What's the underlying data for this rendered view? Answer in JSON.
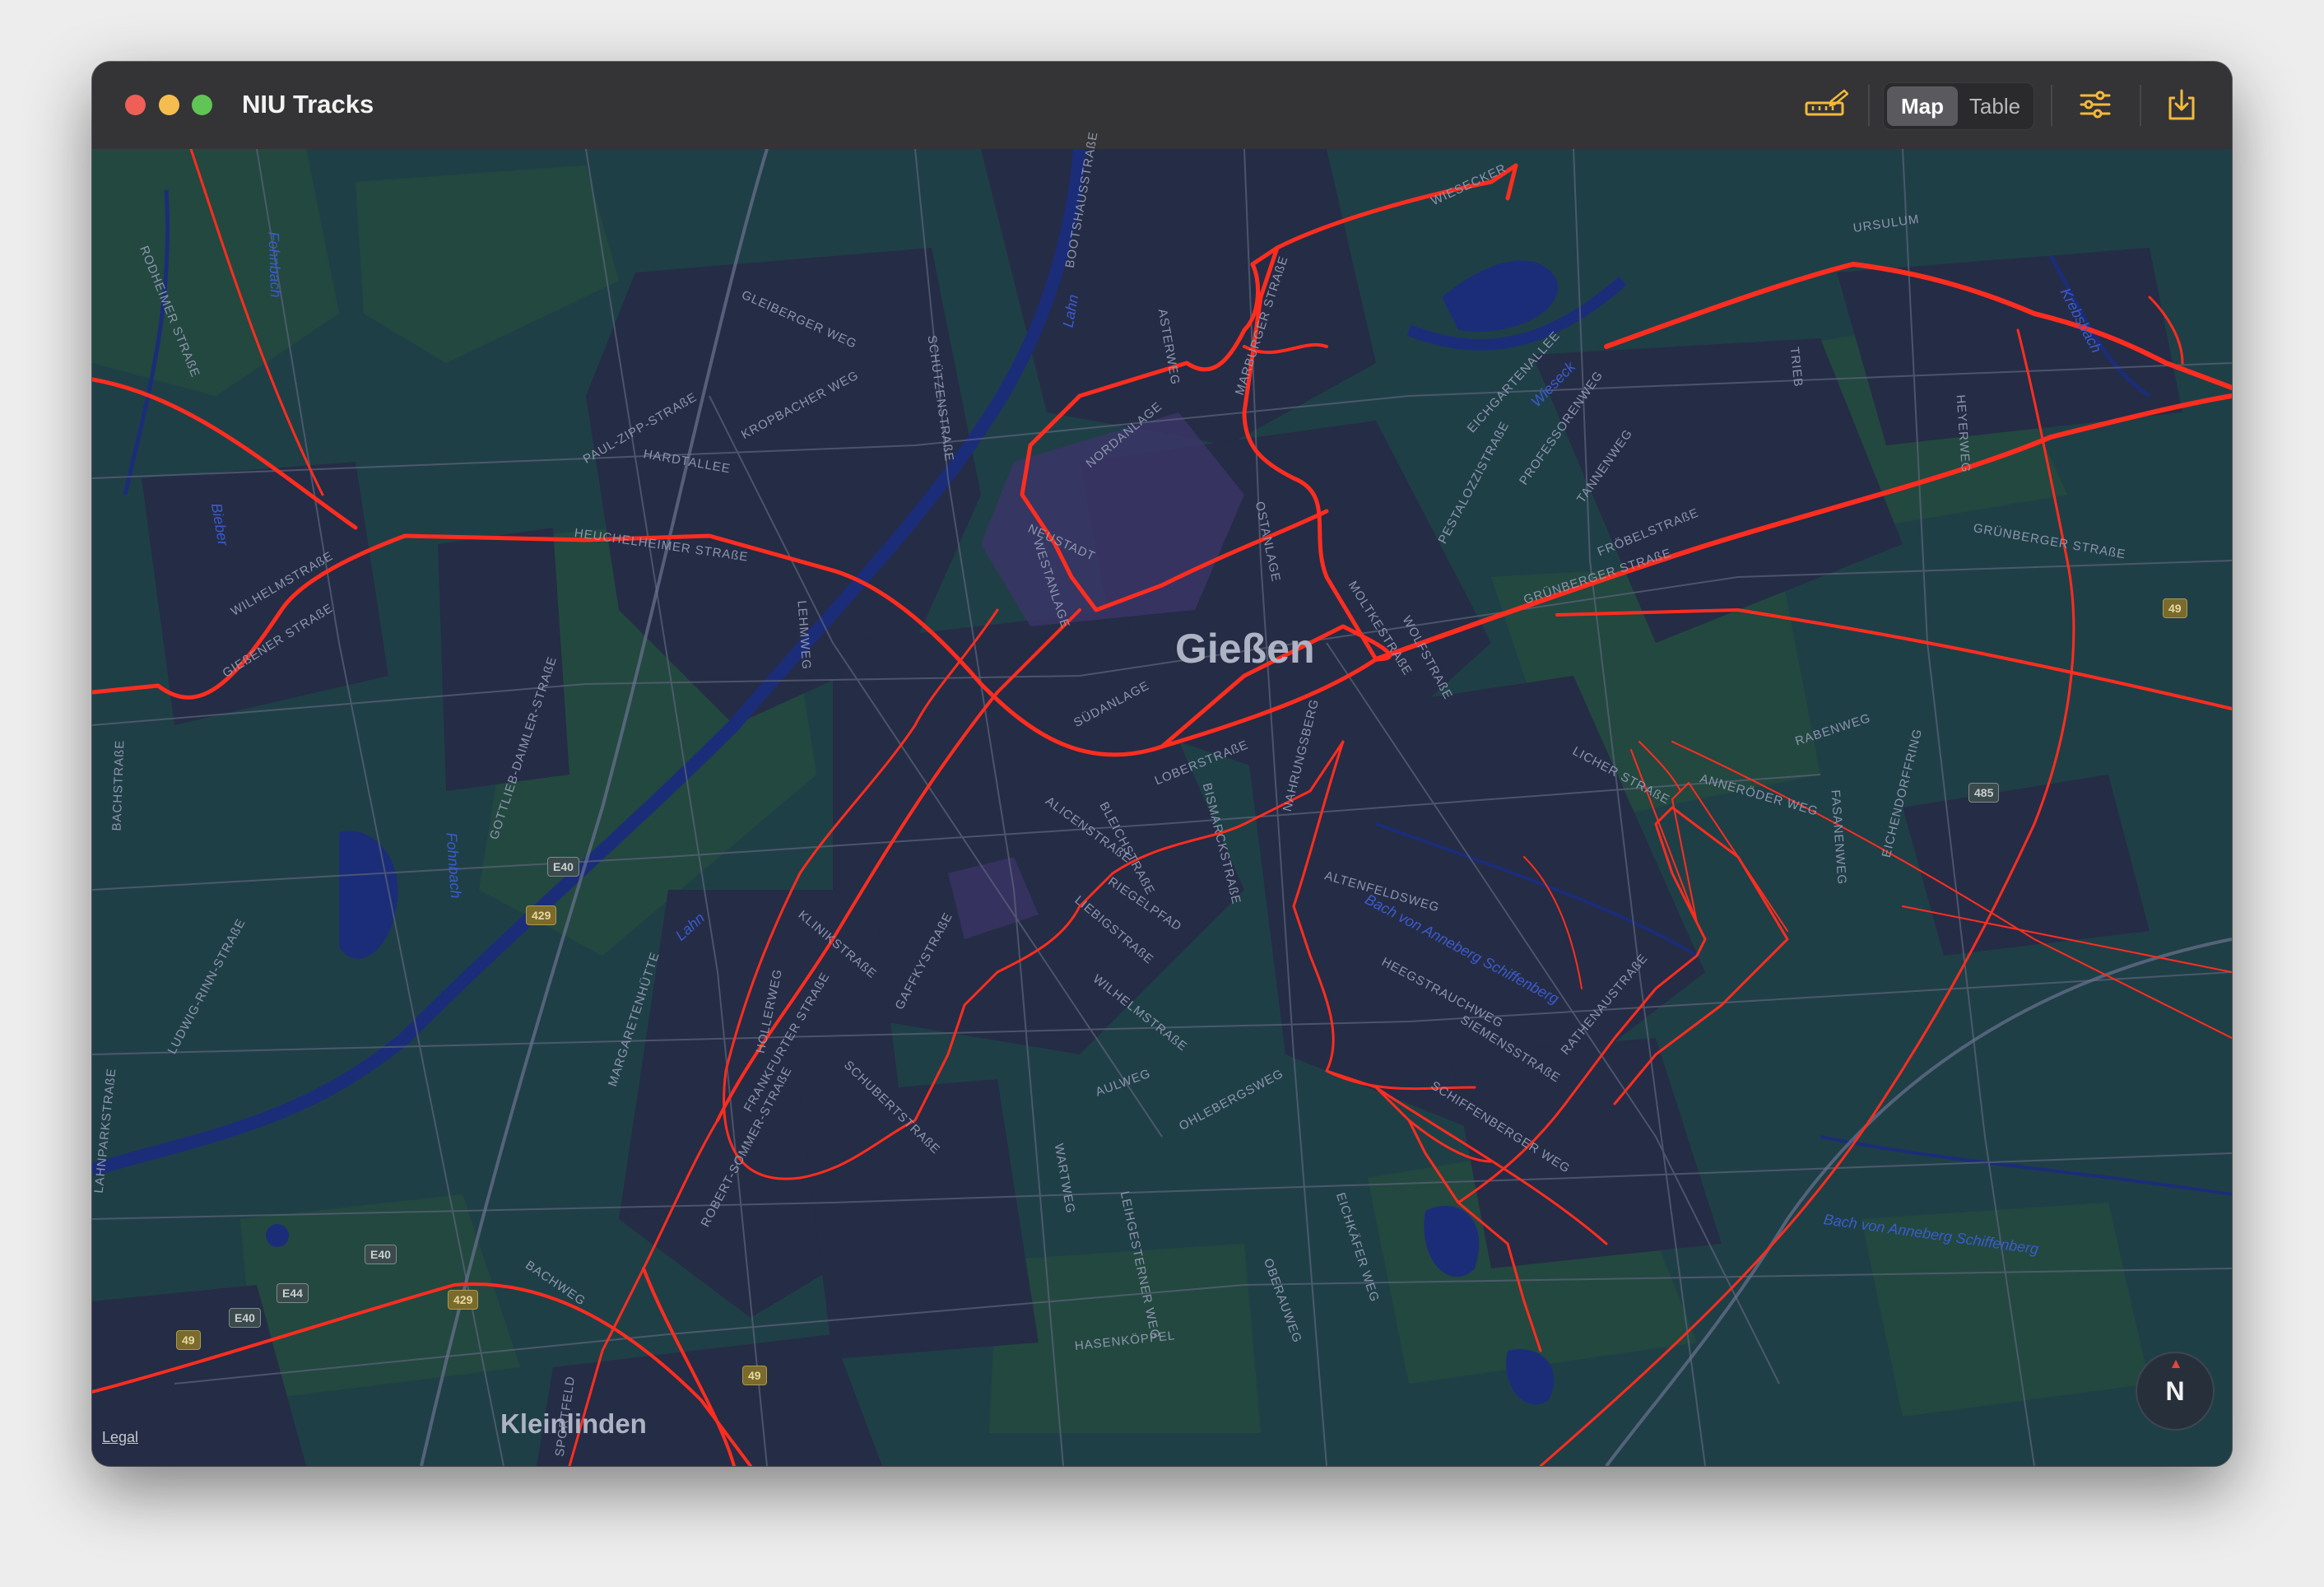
{
  "window": {
    "title": "NIU Tracks"
  },
  "toolbar": {
    "icons": [
      "ruler-pencil-icon",
      "scooter-icon",
      "sliders-icon",
      "export-icon"
    ],
    "view_toggle": {
      "options": [
        "Map",
        "Table"
      ],
      "selected": "Map"
    },
    "accent_color": "#f5b93a"
  },
  "map": {
    "city_labels": [
      "Gießen",
      "Kleinlinden"
    ],
    "street_labels": [
      "RODHEIMER STRAßE",
      "WILHELMSTRAßE",
      "GIEßENER STRAßE",
      "BACHSTRAßE",
      "HEUCHELHEIMER STRAßE",
      "HARDTALLEE",
      "PAUL-ZIPP-STRAßE",
      "KROPBACHER WEG",
      "GLEIBERGER WEG",
      "SCHÜTZENSTRAßE",
      "BOOTSHAUSSTRAßE",
      "ASTERWEG",
      "NORDANLAGE",
      "MARBURGER STRAßE",
      "WIESECKER",
      "URSULUM",
      "EICHGARTENALLEE",
      "PROFESSORENWEG",
      "TANNENWEG",
      "FRÖBELSTRAßE",
      "GRÜNBERGER STRAßE",
      "MOLTKESTRAßE",
      "OSTANLAGE",
      "WESTANLAGE",
      "SÜDANLAGE",
      "NEUSTADT",
      "LICHER STRAßE",
      "ANNERÖDER WEG",
      "RABENWEG",
      "FASANENWEG",
      "EICHENDORFFRING",
      "BISMARCKSTRAßE",
      "NAHRUNGSBERG",
      "ALICENSTRAßE",
      "BLEICHSTRAßE",
      "LOBERSTRAßE",
      "RIEGELPFAD",
      "LIEBIGSTRAßE",
      "WILHELMSTRAßE",
      "ALTENFELDSWEG",
      "HEEGSTRAUCHWEG",
      "SIEMENSSTRAßE",
      "SCHIFFENBERGER WEG",
      "RATHENAUSTRAßE",
      "KLINIKSTRAßE",
      "FRANKFURTER STRAßE",
      "HOLLERWEG",
      "GAFFKYSTRAßE",
      "SCHUBERTSTRAßE",
      "ROBERT-SOMMER-STRAßE",
      "MARGARETENHÜTTE",
      "AULWEG",
      "WARTWEG",
      "LEIHGESTERNER WEG",
      "OHLEBERGSWEG",
      "EICHKÄFER WEG",
      "OBERAUWEG",
      "HASENKÖPPEL",
      "BACHWEG",
      "SPORTFELD",
      "LAHNPARKSTRAßE",
      "LUDWIG-RINN-STRAßE",
      "GOTTLIEB-DAIMLER-STRAßE",
      "LEHMWEG",
      "TRIEB",
      "HEYERWEG",
      "PESTALOZZISTRAßE",
      "WOLFSTRAßE"
    ],
    "water_labels": [
      "Lahn",
      "Lahn",
      "Wieseck",
      "Krebsbach",
      "Fohnbach",
      "Fohnbach",
      "Bieber",
      "Bach von Anneberg Schiffenberg",
      "Bach von Anneberg Schiffenberg"
    ],
    "road_shields": [
      "49",
      "429",
      "E40",
      "E40",
      "E44",
      "E40",
      "429",
      "49",
      "485",
      "49"
    ],
    "legal_link": "Legal",
    "compass_letter": "N",
    "track_color": "#ff2d1f",
    "water_color": "#1b2d78"
  }
}
